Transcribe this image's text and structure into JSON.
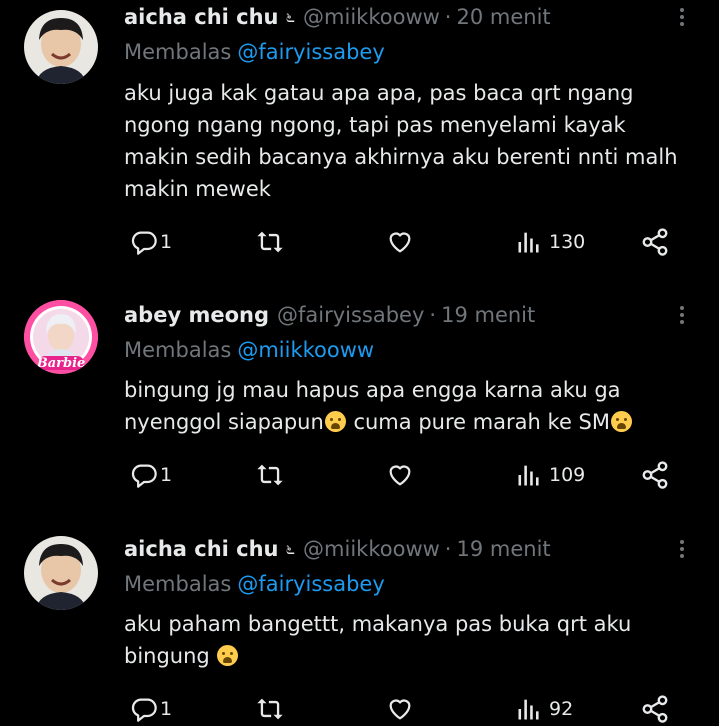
{
  "tweets": [
    {
      "name": "aicha chi chu",
      "badge": "೬",
      "handle": "@miikkooww",
      "time": "20 menit",
      "reply_prefix": "Membalas",
      "reply_to": "@fairyissabey",
      "text": "aku juga kak gatau apa apa, pas baca qrt ngang\nngong ngang ngong, tapi pas menyelami kayak\nmakin sedih bacanya akhirnya aku berenti nnti malh\nmakin mewek",
      "replies": "1",
      "views": "130"
    },
    {
      "name": "abey meong",
      "handle": "@fairyissabey",
      "time": "19 menit",
      "reply_prefix": "Membalas",
      "reply_to": "@miikkooww",
      "text_line1": "bingung jg mau hapus apa engga karna aku ga",
      "text_line2a": "nyenggol siapapun",
      "text_line2b": " cuma pure marah ke SM",
      "avatar_logo": "Barbie",
      "replies": "1",
      "views": "109"
    },
    {
      "name": "aicha chi chu",
      "badge": "೬",
      "handle": "@miikkooww",
      "time": "19 menit",
      "reply_prefix": "Membalas",
      "reply_to": "@fairyissabey",
      "text_line1": "aku paham bangettt, makanya pas buka qrt aku",
      "text_line2": "bingung",
      "replies": "1",
      "views": "92"
    }
  ],
  "icons": {
    "reply": "reply-icon",
    "retweet": "retweet-icon",
    "like": "heart-icon",
    "views": "views-icon",
    "share": "share-icon",
    "more": "more-icon",
    "emoji": "loudly-crying-emoji"
  },
  "colors": {
    "background": "#000000",
    "text": "#e7e9ea",
    "muted": "#71767b",
    "link": "#1d9bf0",
    "avatar_ring": "#e8248c"
  }
}
